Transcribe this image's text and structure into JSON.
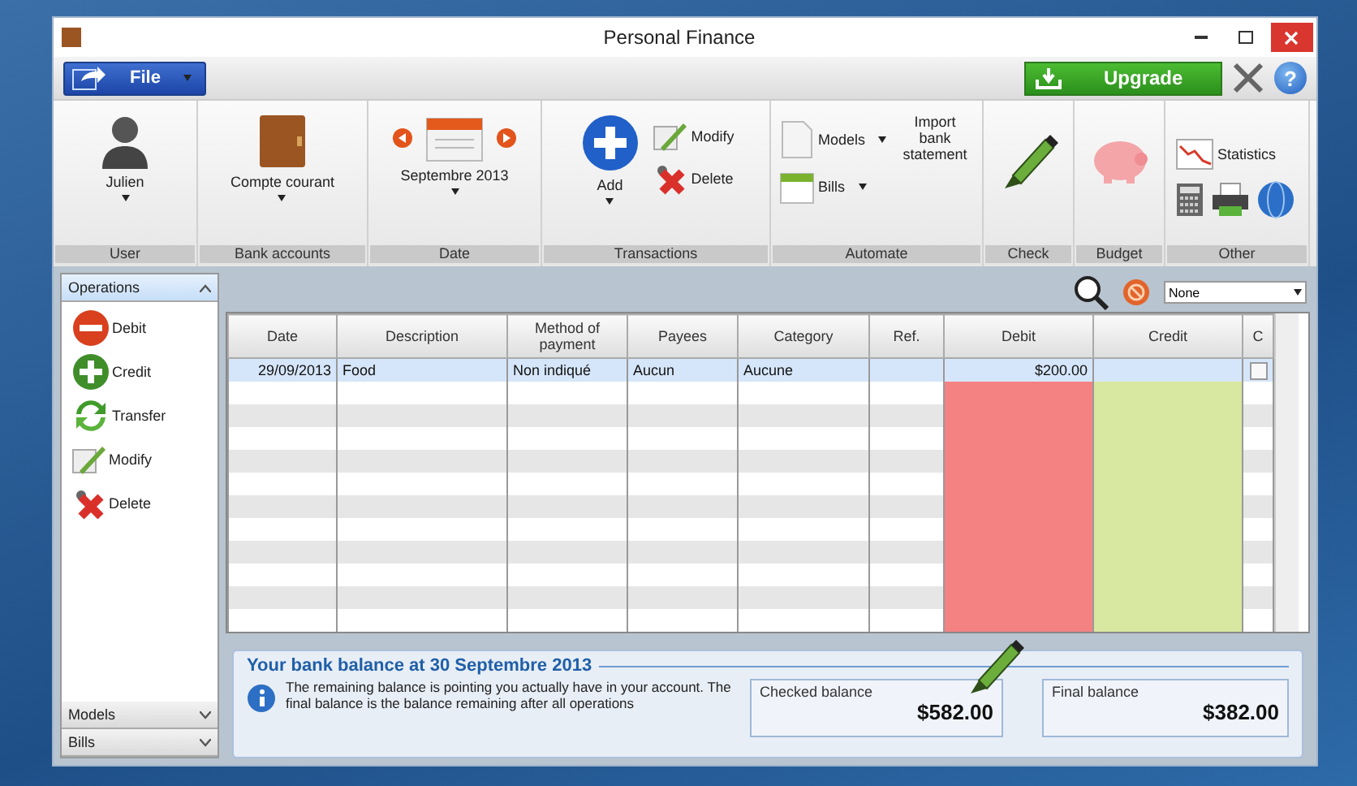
{
  "window": {
    "title": "Personal Finance"
  },
  "menu": {
    "file": "File",
    "upgrade": "Upgrade",
    "help": "?"
  },
  "ribbon": [
    {
      "label": "User",
      "items": [
        {
          "kind": "big",
          "text": "Julien",
          "dropdown": true
        }
      ]
    },
    {
      "label": "Bank accounts",
      "items": [
        {
          "kind": "big",
          "text": "Compte courant",
          "dropdown": true
        }
      ]
    },
    {
      "label": "Date",
      "items": [
        {
          "kind": "date",
          "text": "Septembre 2013",
          "dropdown": true
        }
      ]
    },
    {
      "label": "Transactions",
      "items": [
        {
          "kind": "big",
          "text": "Add",
          "dropdown": true
        },
        {
          "kind": "small",
          "text": "Modify"
        },
        {
          "kind": "small",
          "text": "Delete"
        }
      ]
    },
    {
      "label": "Automate",
      "items": [
        {
          "kind": "small",
          "text": "Models",
          "dropdown": true
        },
        {
          "kind": "small",
          "text": "Bills",
          "dropdown": true
        },
        {
          "kind": "big",
          "text": "Import bank statement"
        }
      ]
    },
    {
      "label": "Check",
      "items": [
        {
          "kind": "icon"
        }
      ]
    },
    {
      "label": "Budget",
      "items": [
        {
          "kind": "icon"
        }
      ]
    },
    {
      "label": "Other",
      "items": [
        {
          "kind": "small",
          "text": "Statistics"
        },
        {
          "kind": "icon"
        },
        {
          "kind": "icon"
        },
        {
          "kind": "icon"
        }
      ]
    }
  ],
  "sidebar": [
    {
      "label": "Operations",
      "expanded": true,
      "items": [
        "Debit",
        "Credit",
        "Transfer",
        "Modify",
        "Delete"
      ]
    },
    {
      "label": "Models",
      "expanded": false
    },
    {
      "label": "Bills",
      "expanded": false
    }
  ],
  "filter": {
    "value": "None"
  },
  "table": {
    "columns": [
      "Date",
      "Description",
      "Method of payment",
      "Payees",
      "Category",
      "Ref.",
      "Debit",
      "Credit",
      "C"
    ],
    "rows": [
      {
        "date": "29/09/2013",
        "description": "Food",
        "method": "Non indiqué",
        "payee": "Aucun",
        "category": "Aucune",
        "debit": "$200.00",
        "checked": false,
        "selected": true
      }
    ]
  },
  "balance": {
    "title": "Your bank balance at 30 Septembre 2013",
    "info": "The remaining balance is pointing you actually have in your account. The final balance is the balance remaining after all operations",
    "checked": {
      "label": "Checked balance",
      "amount": "$582.00"
    },
    "final": {
      "label": "Final balance",
      "amount": "$382.00"
    }
  }
}
